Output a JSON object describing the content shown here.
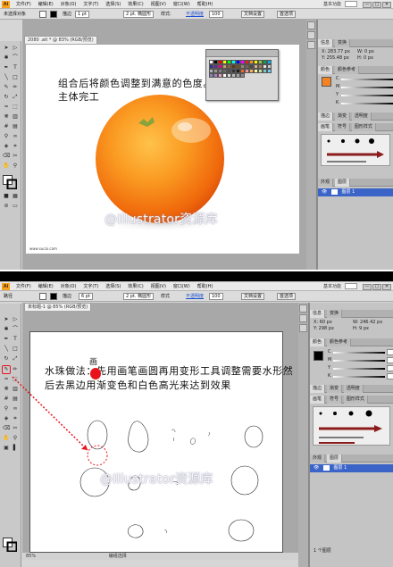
{
  "app": {
    "logo": "Ai",
    "workspace": "基本功能",
    "window_buttons": [
      "—",
      "□",
      "✕"
    ]
  },
  "menu": [
    "文件(F)",
    "编辑(E)",
    "对象(O)",
    "文字(T)",
    "选择(S)",
    "效果(C)",
    "视图(V)",
    "窗口(W)",
    "帮助(H)"
  ],
  "top": {
    "controls": {
      "selection_label": "未选择对象",
      "stroke_label": "描边",
      "stroke_weight": "1 pt",
      "brush_style": "2 pt. 椭圆形",
      "style_label": "样式:",
      "opacity_label": "不透明度",
      "opacity": "100",
      "doc_setup": "文档设置",
      "preferences": "首选项"
    },
    "doc_tab": "2080 .ait * @ 83% (RGB/预览)",
    "caption": "组合后将颜色调整到满意的色度。主体完工",
    "watermark": "@Illustrator资源库",
    "small_url": "www.sucai.com",
    "panels": {
      "color_tabs": [
        "颜色",
        "颜色参考"
      ],
      "coords": {
        "x": "283.77 px",
        "y": "255.48 px",
        "w": "0 px",
        "h": "0 px"
      },
      "gradient_tabs": [
        "描边",
        "渐变",
        "透明度"
      ],
      "brush_tabs": [
        "画笔",
        "符号",
        "图形样式"
      ],
      "layer_tabs": [
        "外观",
        "图层"
      ],
      "layer_name": "图层 1"
    }
  },
  "bottom": {
    "controls": {
      "selection_label": "路径",
      "stroke_label": "描边",
      "stroke_weight": "6 pt",
      "brush_style": "2 pt. 椭圆形",
      "style_label": "样式",
      "opacity_label": "不透明度",
      "opacity": "100",
      "doc_setup": "文档设置",
      "preferences": "首选项"
    },
    "doc_tab": "未标题-1 @ 85% (RGB/预览)",
    "caption_line1": "水珠做法：先用画笔画圆再用变形工具调整需要水形然",
    "caption_line2": "后去黑边用渐变色和白色高光来达到效果",
    "annotation": "画",
    "watermark": "@Illustrator资源库",
    "zoom": "85%",
    "status": "编组选择",
    "panels": {
      "color_tabs": [
        "颜色",
        "颜色参考"
      ],
      "coords": {
        "x": "60 px",
        "y": "298 px",
        "w": "246.42 px",
        "h": "9 px"
      },
      "gradient_tabs": [
        "描边",
        "渐变",
        "透明度"
      ],
      "brush_tabs": [
        "画笔",
        "符号",
        "图形样式"
      ],
      "layer_tabs": [
        "外观",
        "图层"
      ],
      "layer_name": "图层 1",
      "layer_footer": "1 个图层"
    }
  },
  "colors": {
    "accent_orange": "#f58220",
    "highlight_red": "#e8141b",
    "layer_blue": "#3a64c8",
    "brush_red": "#8c1c1c"
  }
}
